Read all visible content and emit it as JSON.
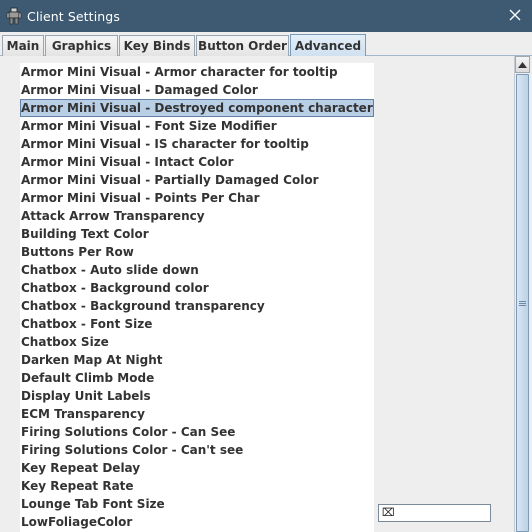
{
  "window": {
    "title": "Client Settings",
    "icon": "mech-app-icon",
    "close_glyph": "✕"
  },
  "tabs": [
    {
      "label": "Main",
      "active": false
    },
    {
      "label": "Graphics",
      "active": false
    },
    {
      "label": "Key Binds",
      "active": false
    },
    {
      "label": "Button Order",
      "active": false
    },
    {
      "label": "Advanced",
      "active": true
    }
  ],
  "settings_list": {
    "selected_index": 2,
    "items": [
      "Armor Mini Visual - Armor character for tooltip",
      "Armor Mini Visual - Damaged Color",
      "Armor Mini Visual - Destroyed component character for tooltip",
      "Armor Mini Visual - Font Size Modifier",
      "Armor Mini Visual - IS character for tooltip",
      "Armor Mini Visual - Intact Color",
      "Armor Mini Visual - Partially Damaged Color",
      "Armor Mini Visual - Points Per Char",
      "Attack Arrow Transparency",
      "Building Text Color",
      "Buttons Per Row",
      "Chatbox - Auto slide down",
      "Chatbox - Background color",
      "Chatbox - Background transparency",
      "Chatbox - Font Size",
      "Chatbox Size",
      "Darken Map At Night",
      "Default Climb Mode",
      "Display Unit Labels",
      "ECM Transparency",
      "Firing Solutions Color - Can See",
      "Firing Solutions Color - Can't see",
      "Key Repeat Delay",
      "Key Repeat Rate",
      "Lounge Tab Font Size",
      "LowFoliageColor"
    ]
  },
  "value_field": {
    "value": "⌧"
  },
  "scrollbar": {
    "up_glyph": "▲"
  },
  "colors": {
    "titlebar": "#3e5a72",
    "selection": "#b8cfe5",
    "active_tab": "#cfe0f0"
  }
}
